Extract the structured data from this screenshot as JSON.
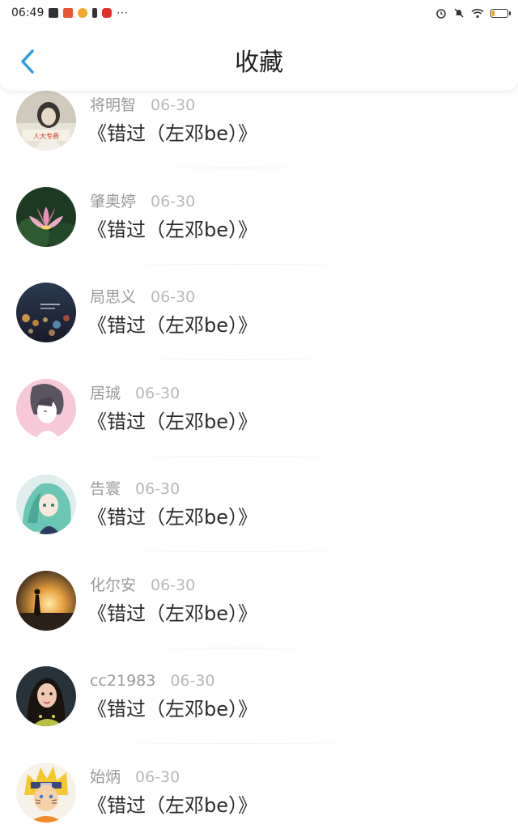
{
  "status_bar": {
    "time": "06:49",
    "more": "···",
    "battery_level": 0.2
  },
  "header": {
    "title": "收藏",
    "back_icon": "chevron-left-icon"
  },
  "colors": {
    "accent": "#2b9be8",
    "text": "#2a2a2a",
    "meta": "#9a9a9a",
    "date": "#b8b8b8"
  },
  "favorites": [
    {
      "user": "将明智",
      "date": "06-30",
      "song": "《错过（左邓be）》",
      "avatar": "avatar-girl-photo"
    },
    {
      "user": "肇奥婷",
      "date": "06-30",
      "song": "《错过（左邓be）》",
      "avatar": "avatar-lotus"
    },
    {
      "user": "局思义",
      "date": "06-30",
      "song": "《错过（左邓be）》",
      "avatar": "avatar-bokeh-lights"
    },
    {
      "user": "居珹",
      "date": "06-30",
      "song": "《错过（左邓be）》",
      "avatar": "avatar-anime-sketch"
    },
    {
      "user": "告寰",
      "date": "06-30",
      "song": "《错过（左邓be）》",
      "avatar": "avatar-anime-green-hair"
    },
    {
      "user": "化尔安",
      "date": "06-30",
      "song": "《错过（左邓be）》",
      "avatar": "avatar-sunset-silhouette"
    },
    {
      "user": "cc21983",
      "date": "06-30",
      "song": "《错过（左邓be）》",
      "avatar": "avatar-woman-portrait"
    },
    {
      "user": "始炳",
      "date": "06-30",
      "song": "《错过（左邓be）》",
      "avatar": "avatar-naruto"
    }
  ]
}
